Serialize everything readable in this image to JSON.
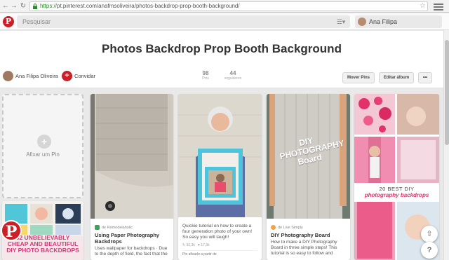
{
  "browser": {
    "url_scheme": "https://",
    "url_rest": "pt.pinterest.com/anafmsoliveira/photos-backdrop-prop-booth-background/"
  },
  "header": {
    "search_placeholder": "Pesquisar",
    "user_name": "Ana Filipa"
  },
  "board": {
    "title": "Photos Backdrop Prop Booth Background",
    "owner": "Ana Filipa Oliveira",
    "invite_label": "Convidar",
    "pins_count": "98",
    "pins_label": "Pins",
    "followers_count": "44",
    "followers_label": "seguidores",
    "move_pins_label": "Mover Pins",
    "edit_board_label": "Editar álbum",
    "more_label": "•••"
  },
  "add_pin_label": "Afixar um Pin",
  "pins": [
    {
      "source": "de Remodelaholic",
      "title": "Using Paper Photography Backdrops",
      "description": "Uses wallpaper for backdrops · Due to the depth of field, the fact that the"
    },
    {
      "description": "Quickie tutorial on how to create a four generation photo of your own! So easy you will laugh!",
      "repins": "92,3k",
      "likes": "17,3k",
      "pinned_from": "Pin afixado a partir de"
    },
    {
      "source": "de Live Simply",
      "title": "DIY Photography Board",
      "description": "How to make a DIY Photography Board in three simple steps! This tutorial is so easy to follow and"
    }
  ],
  "image_texts": {
    "diy_board": "DIY PHOTOGRAPHY Board",
    "best_diy_line1": "20 BEST DIY",
    "best_diy_line2": "photography backdrops",
    "unbelievably_line1": "32 UNBELIEVABLY",
    "unbelievably_line2": "CHEAP AND BEAUTIFUL",
    "unbelievably_line3": "DIY PHOTO BACKDROPS"
  },
  "float_help": "?",
  "colors": {
    "brand": "#cb2027"
  }
}
